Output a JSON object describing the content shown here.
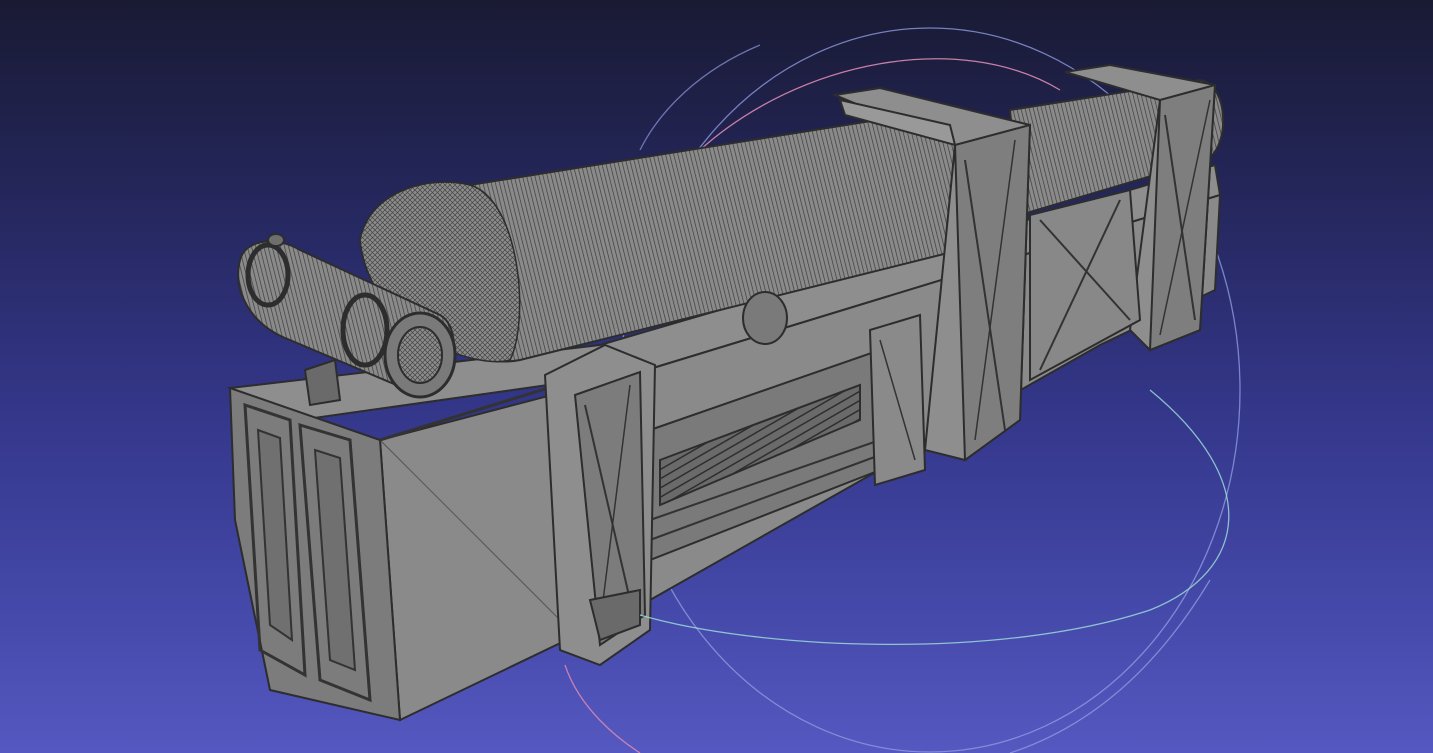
{
  "app": {
    "window_title": ""
  },
  "viewport": {
    "background_top": "#191a33",
    "background_bottom": "#5558c0",
    "mesh_face_color": "#8c8c8c",
    "mesh_wire_color": "#3a3a3a",
    "trackball_colors": {
      "x_ring": "#d98ab0",
      "y_ring": "#8f9ae0",
      "z_ring": "#9ad8d8"
    }
  },
  "model": {
    "parts": [
      "base-block",
      "cylindrical-tank",
      "end-cap",
      "front-frame",
      "middle-frame",
      "rear-frame",
      "side-vent",
      "pipe-fitting"
    ]
  }
}
